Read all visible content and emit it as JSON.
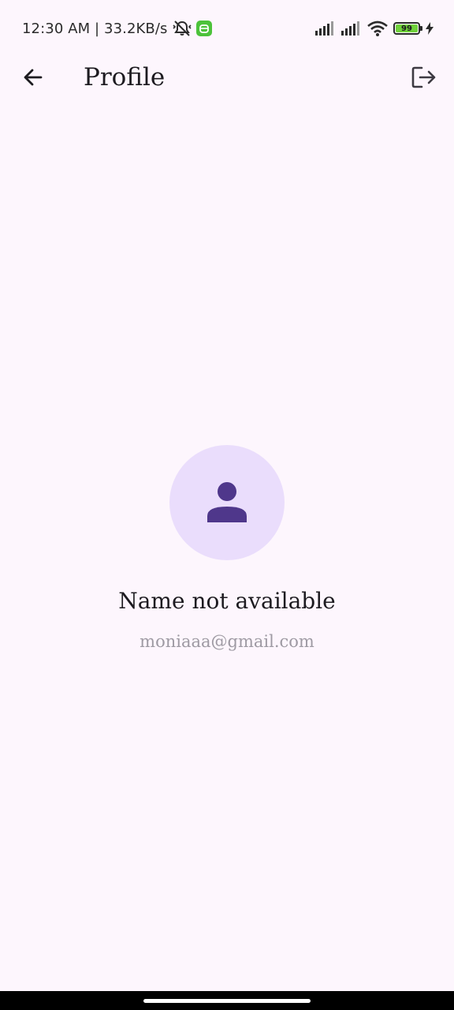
{
  "status_bar": {
    "time_speed": "12:30 AM | 33.2KB/s",
    "battery_level": "99",
    "icons": [
      "vibrate-off-icon",
      "app-notification-icon",
      "signal-icon",
      "signal-icon",
      "wifi-icon",
      "battery-icon",
      "charging-icon"
    ],
    "notification_color": "#4cc23a",
    "battery_color": "#6fd13a"
  },
  "app_bar": {
    "title": "Profile",
    "back_icon": "arrow-back-icon",
    "logout_icon": "logout-icon"
  },
  "profile": {
    "avatar_icon": "person-icon",
    "name": "Name not available",
    "email": "moniaaa@gmail.com"
  },
  "colors": {
    "background": "#fdf6fd",
    "avatar_bg": "#eaddfc",
    "avatar_icon": "#4f378b",
    "title_text": "#1d1b20",
    "email_text": "#9e9aa3"
  }
}
